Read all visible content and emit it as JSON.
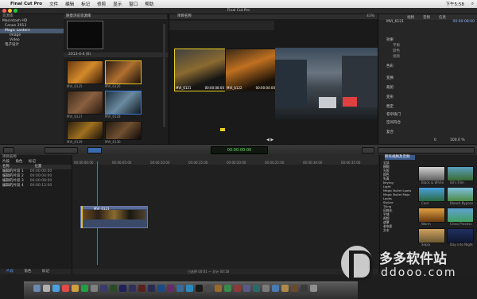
{
  "menubar": {
    "app": "Final Cut Pro",
    "items": [
      "文件",
      "编辑",
      "标记",
      "修剪",
      "显示",
      "窗口",
      "帮助"
    ],
    "clock": "下午5:58"
  },
  "window_title": "Final Cut Pro",
  "library": {
    "header": "资源库",
    "items": [
      {
        "label": "Macintosh HD"
      },
      {
        "label": "Canon 2013"
      },
      {
        "label": "Magic Lantern"
      },
      {
        "label": "Image"
      },
      {
        "label": "Video"
      },
      {
        "label": "电子设计"
      }
    ]
  },
  "browser": {
    "header": "随意浏览资源库",
    "group_label": "2013-4-4 (6)",
    "clips": [
      "MVI_6125",
      "MVI_6126",
      "MVI_6127",
      "MVI_6128",
      "MVI_6129",
      "MVI_6130"
    ],
    "footer": "已选择 1 项，共 10 项"
  },
  "viewer": {
    "header": "项目名称",
    "clip1": {
      "name": "MVI_6121",
      "tc": "00:00:08:00"
    },
    "clip2": {
      "name": "MVI_6122",
      "tc": "00:00:04:00"
    },
    "zoom": "43%"
  },
  "inspector": {
    "tabs": [
      "视频",
      "音频",
      "信息"
    ],
    "title": "MVI_6121",
    "tc": "00:00:08:00",
    "sections": [
      "效果",
      "色彩",
      "变换",
      "裁剪",
      "变形",
      "稳定",
      "卷帘快门",
      "空间符合",
      "复合"
    ],
    "sub_items": [
      "平衡",
      "颜色",
      "视频"
    ],
    "values": [
      "100.0 %",
      "0"
    ]
  },
  "toolbar": {
    "timecode": "00:00:00:00"
  },
  "index": {
    "tabs": [
      "片段",
      "角色",
      "标记"
    ],
    "col_name": "名称",
    "col_pos": "位置",
    "rows": [
      {
        "name": "编辑的片段 1",
        "pos": "00:00:00:00"
      },
      {
        "name": "编辑的片段 2",
        "pos": "00:00:04:00"
      },
      {
        "name": "编辑的片段 3",
        "pos": "00:00:08:00"
      },
      {
        "name": "编辑的片段 4",
        "pos": "00:00:12:00"
      }
    ],
    "bottom_tabs": [
      "片段",
      "角色",
      "标记"
    ]
  },
  "timeline": {
    "header": "项目名称",
    "ruler": [
      "00:00:00:00",
      "00:00:05:00",
      "00:00:10:00",
      "00:00:15:00",
      "00:00:20:00",
      "00:00:25:00",
      "00:00:30:00",
      "00:00:35:00",
      "00:00:40:00",
      "00:00:45:00"
    ],
    "clip_label": "MVI_6121",
    "footer": "已选择 00:01 — 总计 00:18"
  },
  "effects": {
    "header": "所有视频及音频",
    "categories": [
      "全部",
      "模糊",
      "光照",
      "颜色",
      "失真",
      "Keying",
      "Light",
      "Magic Bullet Looks",
      "Magic Bullet Mojo",
      "Looks",
      "Stylize",
      "Tiling",
      "风格化",
      "平铺",
      "视频",
      "遮罩",
      "老电影",
      "文本"
    ],
    "items": [
      {
        "label": "Black & White"
      },
      {
        "label": "60's Film"
      },
      {
        "label": "Cool"
      },
      {
        "label": "Bleach Bypass"
      },
      {
        "label": "Warm"
      },
      {
        "label": "Cross Process"
      },
      {
        "label": "Sepia"
      },
      {
        "label": "Day into Night"
      }
    ]
  },
  "watermark": {
    "brand": "多多软件站",
    "url": "ddooo.com"
  }
}
